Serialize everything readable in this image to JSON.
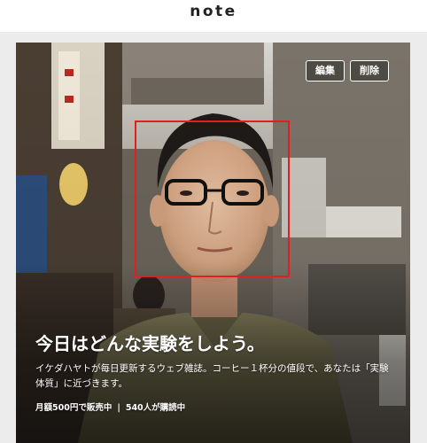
{
  "header": {
    "logo": "note"
  },
  "hero": {
    "buttons": {
      "edit": "編集",
      "delete": "削除"
    },
    "title": "今日はどんな実験をしよう。",
    "description": "イケダハヤトが毎日更新するウェブ雑誌。コーヒー１杯分の値段で、あなたは「実験体質」に近づきます。",
    "price": "月額500円で販売中",
    "separator": "|",
    "subscribers": "540人が購読中"
  },
  "colors": {
    "face_box": "#e02020",
    "logo": "#222222",
    "page_background": "#ececec"
  }
}
